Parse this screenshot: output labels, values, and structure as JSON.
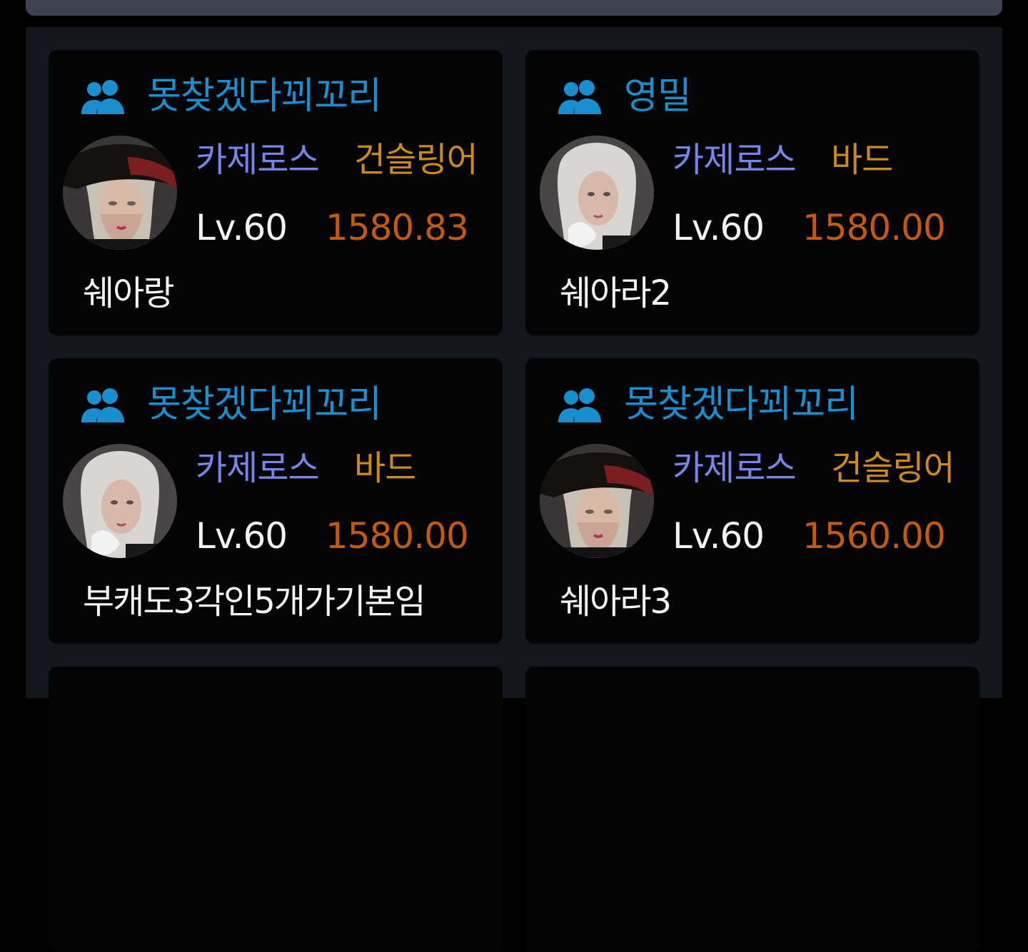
{
  "cards": [
    {
      "guild": "못찾겠다꾀꼬리",
      "server": "카제로스",
      "class": "건슬링어",
      "level": "Lv.60",
      "item_level": "1580.83",
      "name": "쉐아랑",
      "avatar": "gunslinger-portrait"
    },
    {
      "guild": "영밀",
      "server": "카제로스",
      "class": "바드",
      "level": "Lv.60",
      "item_level": "1580.00",
      "name": "쉐아라2",
      "avatar": "bard-portrait"
    },
    {
      "guild": "못찾겠다꾀꼬리",
      "server": "카제로스",
      "class": "바드",
      "level": "Lv.60",
      "item_level": "1580.00",
      "name": "부캐도3각인5개가기본임",
      "avatar": "bard-portrait"
    },
    {
      "guild": "못찾겠다꾀꼬리",
      "server": "카제로스",
      "class": "건슬링어",
      "level": "Lv.60",
      "item_level": "1560.00",
      "name": "쉐아라3",
      "avatar": "gunslinger-portrait"
    }
  ],
  "colors": {
    "guild": "#1a8fd0",
    "server": "#7586e8",
    "class": "#cc8a1c",
    "item_level": "#c45a10",
    "card_bg": "#030406",
    "panel_bg": "#13161c"
  }
}
